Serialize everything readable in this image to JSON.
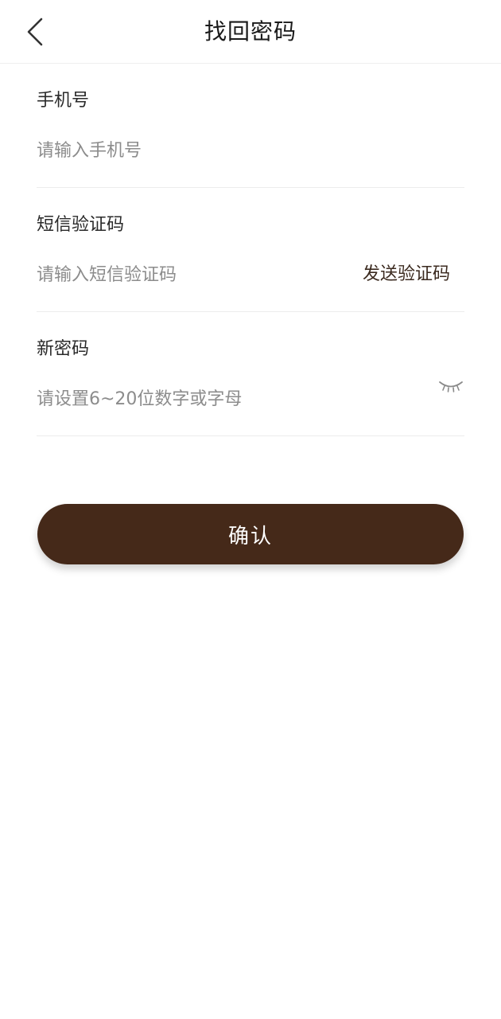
{
  "header": {
    "title": "找回密码",
    "back_icon": "chevron-left-icon"
  },
  "form": {
    "phone": {
      "label": "手机号",
      "placeholder": "请输入手机号",
      "value": ""
    },
    "sms_code": {
      "label": "短信验证码",
      "placeholder": "请输入短信验证码",
      "value": "",
      "send_label": "发送验证码"
    },
    "new_password": {
      "label": "新密码",
      "placeholder": "请设置6~20位数字或字母",
      "value": "",
      "toggle_icon": "eye-closed-icon"
    }
  },
  "actions": {
    "confirm_label": "确认"
  },
  "colors": {
    "primary": "#452919",
    "link": "#3b2a1f",
    "divider": "#ececec",
    "placeholder": "#8c8c8c"
  }
}
